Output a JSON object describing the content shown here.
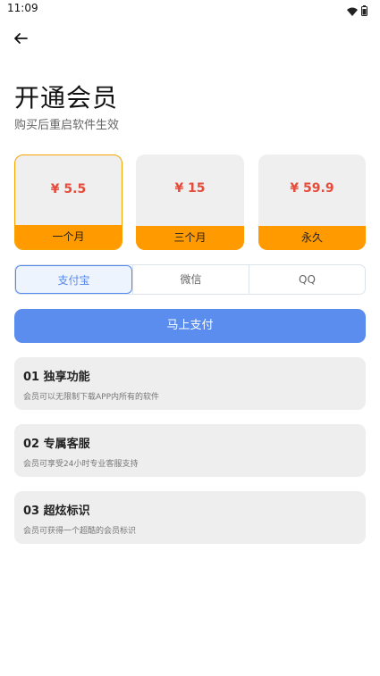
{
  "status_bar": {
    "time": "11:09",
    "icons": [
      "wifi-icon",
      "battery-icon"
    ]
  },
  "header": {
    "back_icon": "arrow-left-icon"
  },
  "page": {
    "title": "开通会员",
    "subtitle": "购买后重启软件生效"
  },
  "plans": [
    {
      "price": "¥ 5.5",
      "label": "一个月",
      "selected": true
    },
    {
      "price": "¥ 15",
      "label": "三个月",
      "selected": false
    },
    {
      "price": "¥ 59.9",
      "label": "永久",
      "selected": false
    }
  ],
  "payment_methods": {
    "options": [
      "支付宝",
      "微信",
      "QQ"
    ],
    "selected": "支付宝"
  },
  "pay_button": {
    "label": "马上支付"
  },
  "features": [
    {
      "title": "01 独享功能",
      "description": "会员可以无限制下载APP内所有的软件"
    },
    {
      "title": "02 专属客服",
      "description": "会员可享受24小时专业客服支持"
    },
    {
      "title": "03 超炫标识",
      "description": "会员可获得一个超酷的会员标识"
    }
  ],
  "colors": {
    "accent_orange": "#ff9a00",
    "price_red": "#e64c3c",
    "primary_blue": "#5b8def"
  }
}
